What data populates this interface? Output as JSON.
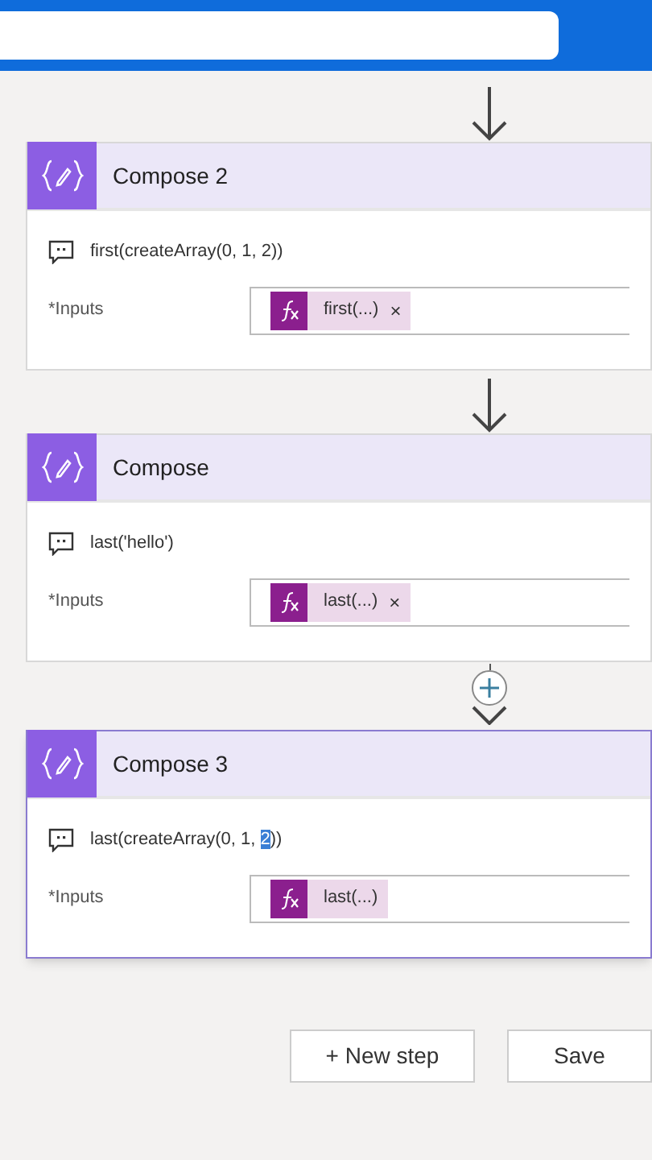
{
  "connectors": [
    {
      "kind": "arrow"
    },
    {
      "kind": "arrow"
    },
    {
      "kind": "plus"
    }
  ],
  "steps": [
    {
      "title": "Compose 2",
      "selected": false,
      "comment_parts": [
        {
          "text": "first(createArray(0, 1, 2))",
          "selected": false
        }
      ],
      "input_label": "*Inputs",
      "chip": {
        "text": "first(...)",
        "close": "×"
      }
    },
    {
      "title": "Compose",
      "selected": false,
      "comment_parts": [
        {
          "text": "last('hello')",
          "selected": false
        }
      ],
      "input_label": "*Inputs",
      "chip": {
        "text": "last(...)",
        "close": "×"
      }
    },
    {
      "title": "Compose 3",
      "selected": true,
      "comment_parts": [
        {
          "text": "last(createArray(0, 1, ",
          "selected": false
        },
        {
          "text": "2",
          "selected": true
        },
        {
          "text": "))",
          "selected": false
        }
      ],
      "input_label": "*Inputs",
      "chip": {
        "text": "last(...)"
      }
    }
  ],
  "buttons": [
    {
      "label": "+ New step",
      "kind": "new"
    },
    {
      "label": "Save",
      "kind": "save"
    }
  ]
}
